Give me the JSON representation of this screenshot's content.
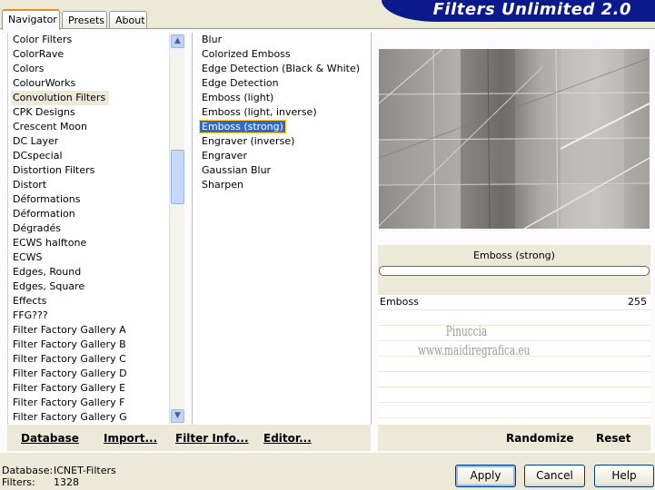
{
  "header": {
    "title": "Filters Unlimited 2.0",
    "tabs": [
      {
        "label": "Navigator",
        "active": true
      },
      {
        "label": "Presets",
        "active": false
      },
      {
        "label": "About",
        "active": false
      }
    ]
  },
  "categories": [
    "Color Filters",
    "ColorRave",
    "Colors",
    "ColourWorks",
    "Convolution Filters",
    "CPK Designs",
    "Crescent Moon",
    "DC Layer",
    "DCspecial",
    "Distortion Filters",
    "Distort",
    "Déformations",
    "Déformation",
    "Dégradés",
    "ECWS halftone",
    "ECWS",
    "Edges, Round",
    "Edges, Square",
    "Effects",
    "FFG???",
    "Filter Factory Gallery A",
    "Filter Factory Gallery B",
    "Filter Factory Gallery C",
    "Filter Factory Gallery D",
    "Filter Factory Gallery E",
    "Filter Factory Gallery F",
    "Filter Factory Gallery G"
  ],
  "selected_category_index": 4,
  "scroll_icons": {
    "up": "▲",
    "down": "▼"
  },
  "filters": [
    "Blur",
    "Colorized Emboss",
    "Edge Detection (Black & White)",
    "Edge Detection",
    "Emboss (light)",
    "Emboss (light, inverse)",
    "Emboss (strong)",
    "Engraver (inverse)",
    "Engraver",
    "Gaussian Blur",
    "Sharpen"
  ],
  "selected_filter_index": 6,
  "preview": {
    "filter_name": "Emboss (strong)"
  },
  "params": [
    {
      "name": "Emboss",
      "value": "255"
    }
  ],
  "watermark": {
    "line1": "Pinuccia",
    "line2": "www.maidiregrafica.eu"
  },
  "left_buttons": {
    "database": "Database",
    "import": "Import...",
    "filter_info": "Filter Info...",
    "editor": "Editor..."
  },
  "right_buttons": {
    "randomize": "Randomize",
    "reset": "Reset"
  },
  "status": {
    "database_label": "Database:",
    "database_value": "ICNET-Filters",
    "filters_label": "Filters:",
    "filters_value": "1328"
  },
  "dialog_buttons": {
    "apply": "Apply",
    "cancel": "Cancel",
    "help": "Help"
  },
  "colors": {
    "banner": "#0a1a8c",
    "selection": "#316ac5",
    "face": "#ece9d8"
  }
}
